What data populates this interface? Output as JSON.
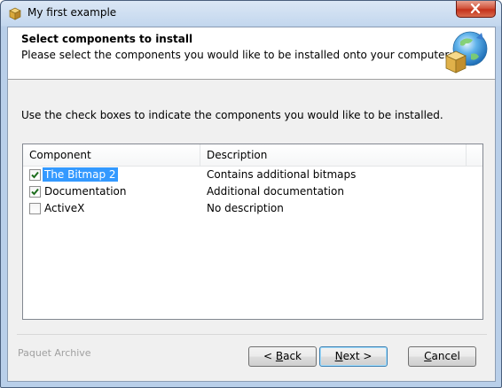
{
  "window": {
    "title": "My first example",
    "app_icon": "installer-box-icon",
    "close_icon": "close-icon"
  },
  "header": {
    "title": "Select components to install",
    "subtitle": "Please select the components you would like to be installed onto your computer:",
    "logo_icon": "box-globe-logo-icon"
  },
  "instructions": "Use the check boxes to indicate the components you would like to be installed.",
  "components": {
    "columns": [
      "Component",
      "Description"
    ],
    "rows": [
      {
        "name": "The Bitmap 2",
        "description": "Contains additional bitmaps",
        "checked": true,
        "selected": true
      },
      {
        "name": "Documentation",
        "description": "Additional documentation",
        "checked": true,
        "selected": false
      },
      {
        "name": "ActiveX",
        "description": "No description",
        "checked": false,
        "selected": false
      }
    ]
  },
  "footer": {
    "brand": "Paquet Archive",
    "back": {
      "mnemonic_prefix": "< ",
      "mnemonic": "B",
      "rest": "ack"
    },
    "next": {
      "mnemonic": "N",
      "rest": "ext >"
    },
    "cancel": {
      "mnemonic": "C",
      "rest": "ancel"
    }
  },
  "colors": {
    "selection": "#3399ff",
    "check": "#1e6e1e",
    "close_button": "#c4321b"
  }
}
